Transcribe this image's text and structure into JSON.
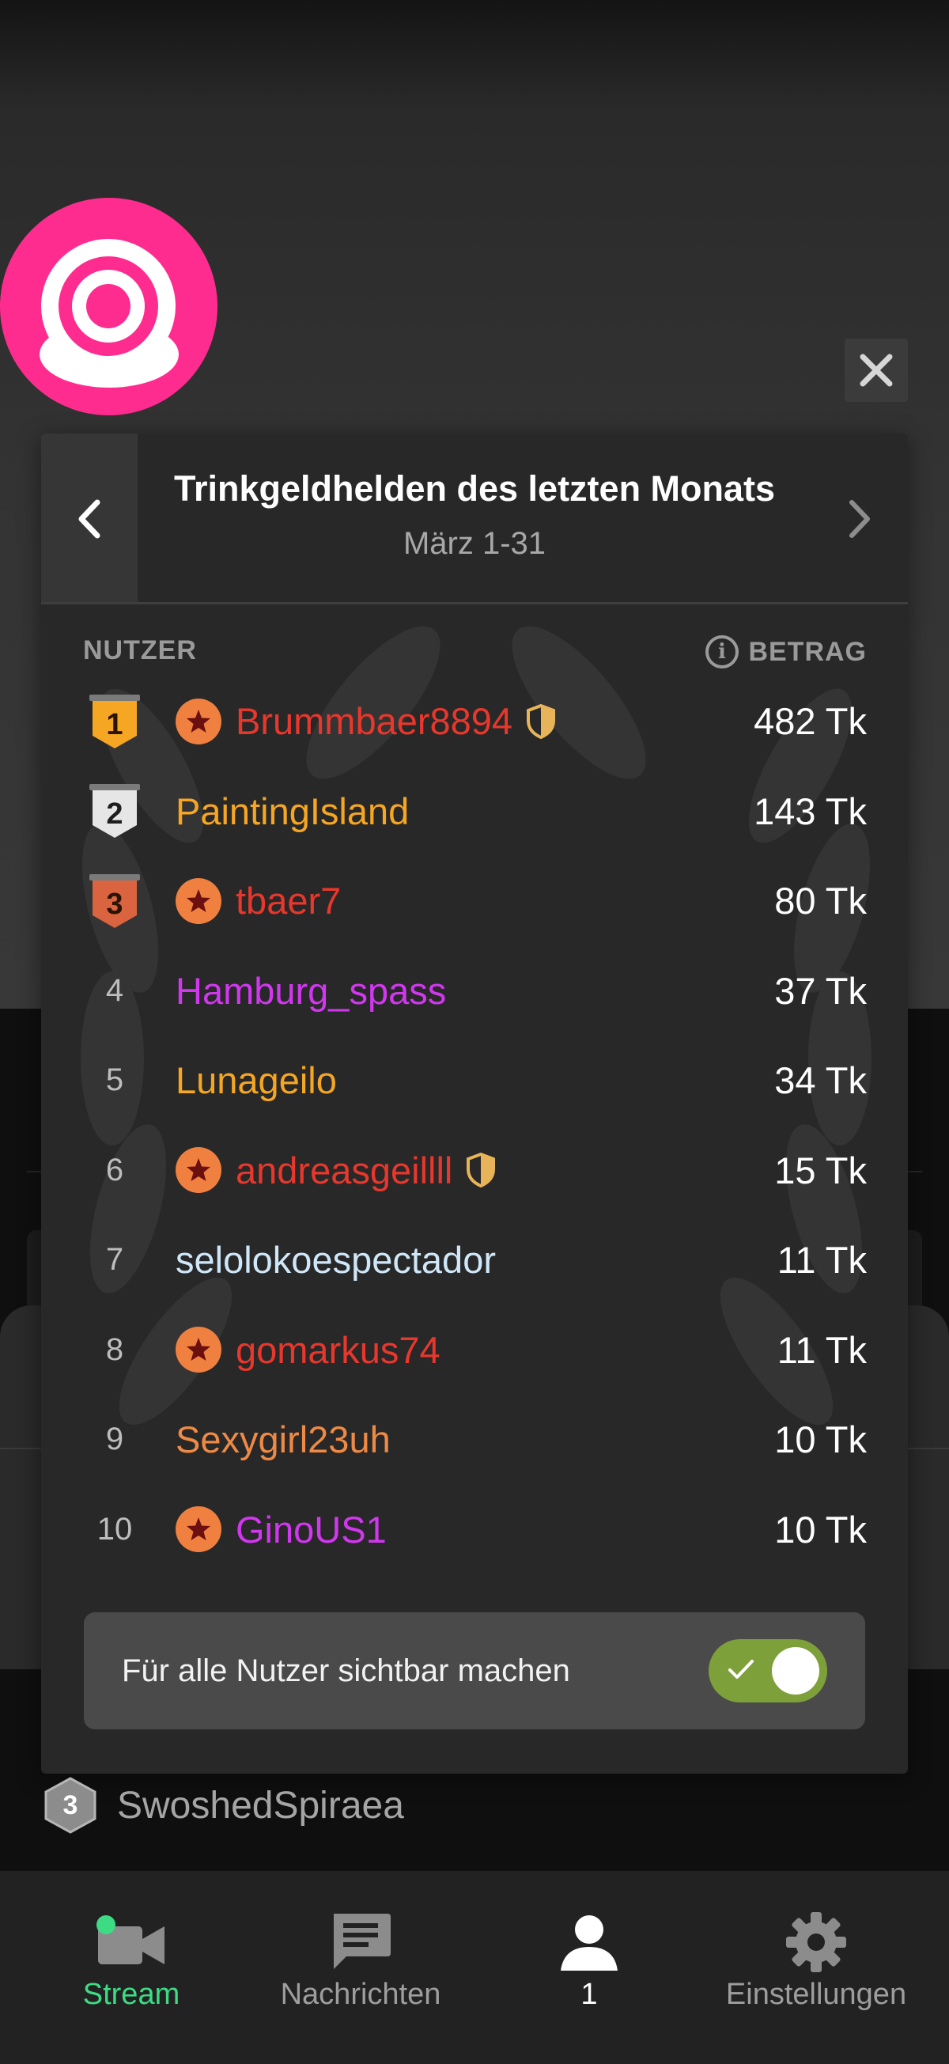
{
  "modal": {
    "title": "Trinkgeldhelden des letzten Monats",
    "period": "März 1-31",
    "col_user": "NUTZER",
    "col_amount": "BETRAG"
  },
  "leaderboard": [
    {
      "rank": "1",
      "name": "Brummbaer8894",
      "amount": "482 Tk",
      "color": "#e8372c",
      "star": true,
      "shield": true
    },
    {
      "rank": "2",
      "name": "PaintingIsland",
      "amount": "143 Tk",
      "color": "#f5a623",
      "star": false,
      "shield": false
    },
    {
      "rank": "3",
      "name": "tbaer7",
      "amount": "80 Tk",
      "color": "#e8372c",
      "star": true,
      "shield": false
    },
    {
      "rank": "4",
      "name": "Hamburg_spass",
      "amount": "37 Tk",
      "color": "#d237f0",
      "star": false,
      "shield": false
    },
    {
      "rank": "5",
      "name": "Lunageilo",
      "amount": "34 Tk",
      "color": "#f5a623",
      "star": false,
      "shield": false
    },
    {
      "rank": "6",
      "name": "andreasgeillll",
      "amount": "15 Tk",
      "color": "#e8372c",
      "star": true,
      "shield": true
    },
    {
      "rank": "7",
      "name": "selolokoespectador",
      "amount": "11 Tk",
      "color": "#cfe7f8",
      "star": false,
      "shield": false
    },
    {
      "rank": "8",
      "name": "gomarkus74",
      "amount": "11 Tk",
      "color": "#e8372c",
      "star": true,
      "shield": false
    },
    {
      "rank": "9",
      "name": "Sexygirl23uh",
      "amount": "10 Tk",
      "color": "#ee8a45",
      "star": false,
      "shield": false
    },
    {
      "rank": "10",
      "name": "GinoUS1",
      "amount": "10 Tk",
      "color": "#d237f0",
      "star": true,
      "shield": false
    }
  ],
  "visibility": {
    "label": "Für alle Nutzer sichtbar machen",
    "enabled": true
  },
  "bottom_user": {
    "level": "3",
    "name": "SwoshedSpiraea"
  },
  "nav": {
    "stream": "Stream",
    "messages": "Nachrichten",
    "profile": "1",
    "settings": "Einstellungen"
  },
  "colors": {
    "brand": "#ff2c8f",
    "stream_active": "#3ddc84",
    "toggle_on": "#7ea03a",
    "gold": "#f5a623",
    "silver": "#e6e6e6",
    "bronze": "#d9643f"
  }
}
